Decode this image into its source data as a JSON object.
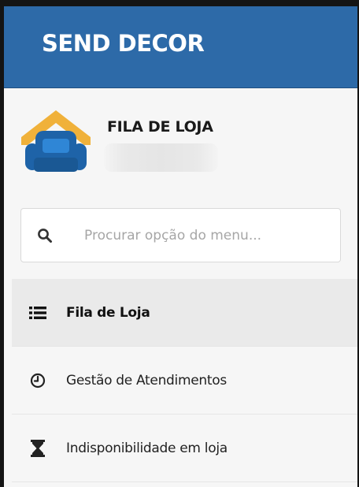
{
  "header": {
    "brand": "SEND DECOR"
  },
  "profile": {
    "store_name": "FILA DE LOJA",
    "logo_icon": "sofa-house-icon"
  },
  "search": {
    "placeholder": "Procurar opção do menu...",
    "icon": "search-icon"
  },
  "menu": {
    "items": [
      {
        "label": "Fila de Loja",
        "icon": "list-icon",
        "active": true
      },
      {
        "label": "Gestão de Atendimentos",
        "icon": "clock-icon",
        "active": false
      },
      {
        "label": "Indisponibilidade em loja",
        "icon": "hourglass-icon",
        "active": false
      }
    ]
  },
  "colors": {
    "header_bg": "#2d6aa8",
    "logo_roof": "#f0b13a",
    "logo_sofa": "#1e63a8",
    "active_item_bg": "#eaeaea"
  }
}
